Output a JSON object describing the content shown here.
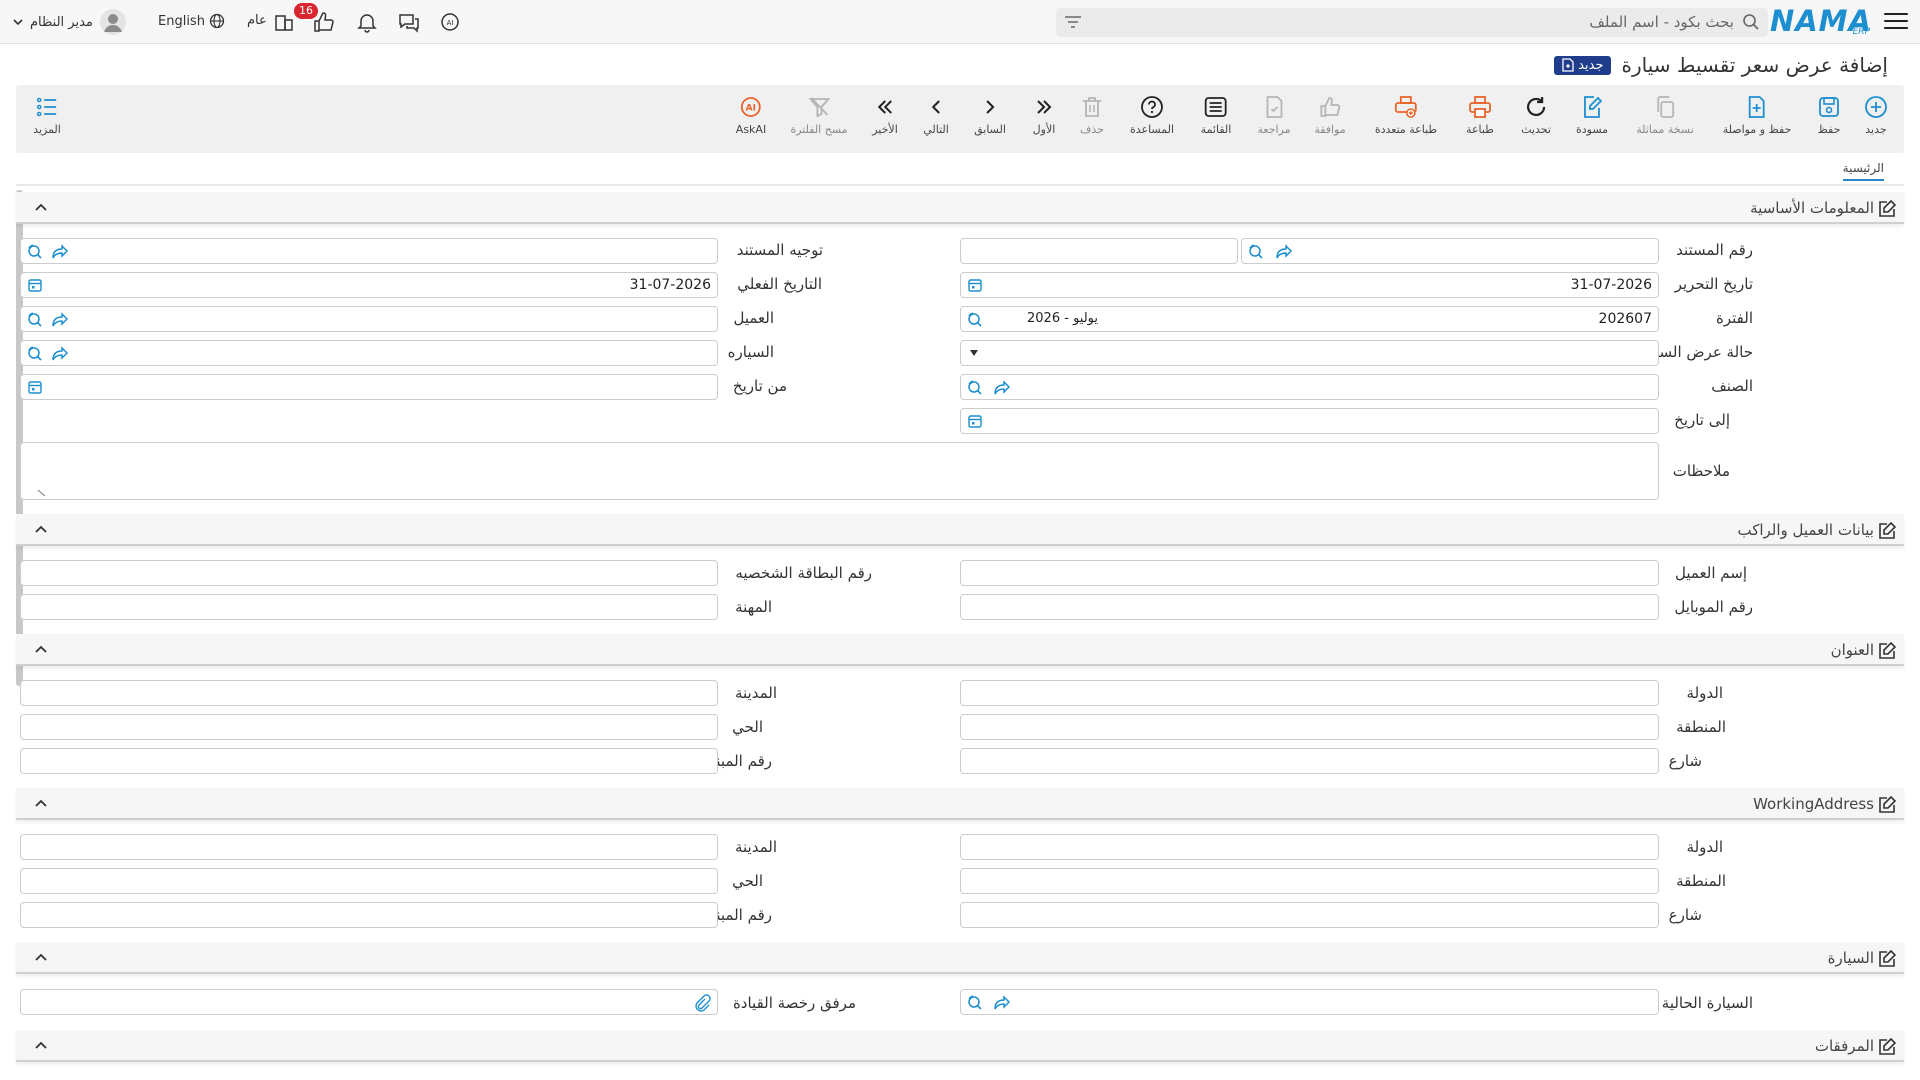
{
  "topbar": {
    "search_placeholder": "بحث بكود - اسم الملف",
    "logo_text": "NAMA",
    "logo_sub": "ERP",
    "notification_count": "16",
    "branch_label": "عام",
    "language_label": "English",
    "user_name": "مدير النظام"
  },
  "page": {
    "title": "إضافة عرض سعر تقسيط سيارة",
    "new_badge": "جديد"
  },
  "toolbar": {
    "new": "جديد",
    "save": "حفظ",
    "save_continue": "حفظ و مواصلة",
    "copy": "نسخة مماثلة",
    "draft": "مسودة",
    "refresh": "تحديث",
    "print": "طباعة",
    "multi_print": "طباعة متعددة",
    "approve": "موافقة",
    "review": "مراجعة",
    "list": "القائمة",
    "help": "المساعدة",
    "delete": "حذف",
    "first": "الأول",
    "previous": "السابق",
    "next": "التالي",
    "last": "الأخير",
    "clear_filter": "مسح الفلترة",
    "askai": "AskAI",
    "more": "المزيد"
  },
  "tabs": {
    "main": "الرئيسية"
  },
  "sections": {
    "basic": {
      "title": "المعلومات الأساسية",
      "doc_number": "رقم المستند",
      "doc_routing": "توجيه المستند",
      "edit_date": "تاريخ التحرير",
      "edit_date_value": "31-07-2026",
      "actual_date": "التاريخ الفعلي",
      "actual_date_value": "31-07-2026",
      "period": "الفترة",
      "period_value": "202607",
      "period_name": "2026 - يوليو",
      "customer": "العميل",
      "quote_status": "حالة عرض السعر",
      "car": "السياره",
      "item": "الصنف",
      "from_date": "من تاريخ",
      "to_date": "إلى تاريخ",
      "notes": "ملاحظات"
    },
    "customer_rider": {
      "title": "بيانات العميل والراكب",
      "customer_name": "إسم العميل",
      "id_number": "رقم البطاقة الشخصيه",
      "mobile": "رقم الموبايل",
      "profession": "المهنة"
    },
    "address": {
      "title": "العنوان",
      "country": "الدولة",
      "city": "المدينة",
      "region": "المنطقة",
      "district": "الحي",
      "street": "شارع",
      "building": "رقم المبني"
    },
    "working_address": {
      "title": "WorkingAddress",
      "country": "الدولة",
      "city": "المدينة",
      "region": "المنطقة",
      "district": "الحي",
      "street": "شارع",
      "building": "رقم المبني"
    },
    "car": {
      "title": "السيارة",
      "current_car": "السيارة الحالية",
      "license_attachment": "مرفق رخصة القيادة"
    },
    "attachments": {
      "title": "المرفقات"
    }
  },
  "colors": {
    "accent": "#1d8fd0",
    "badge": "#d9262f",
    "print_orange": "#e8642c",
    "new_badge": "#1f3d8a"
  }
}
